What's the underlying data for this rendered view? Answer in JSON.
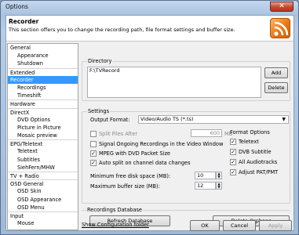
{
  "window": {
    "title": "Options"
  },
  "header": {
    "title": "Recorder",
    "description": "This section offers you to change the recording path, file format settings and buffer size."
  },
  "tree": [
    {
      "label": "General",
      "level": 0
    },
    {
      "label": "Appearance",
      "level": 1
    },
    {
      "label": "Shutdown",
      "level": 1
    },
    {
      "label": "Extended",
      "level": 0,
      "sep": true
    },
    {
      "label": "Recorder",
      "level": 0,
      "selected": true
    },
    {
      "label": "Recordings",
      "level": 1
    },
    {
      "label": "Timeshift",
      "level": 1
    },
    {
      "label": "Hardware",
      "level": 0,
      "sep": true
    },
    {
      "label": "DirectX",
      "level": 0,
      "sep": true
    },
    {
      "label": "DVD Options",
      "level": 1
    },
    {
      "label": "Picture in Picture",
      "level": 1
    },
    {
      "label": "Mosaic preview",
      "level": 1
    },
    {
      "label": "EPG/Teletext",
      "level": 0,
      "sep": true
    },
    {
      "label": "Teletext",
      "level": 1
    },
    {
      "label": "Subtitles",
      "level": 1
    },
    {
      "label": "SiehFern/MHW",
      "level": 1
    },
    {
      "label": "TV + Radio",
      "level": 0,
      "sep": true
    },
    {
      "label": "OSD General",
      "level": 0,
      "sep": true
    },
    {
      "label": "OSD Skin",
      "level": 1
    },
    {
      "label": "OSD Appearance",
      "level": 1
    },
    {
      "label": "OSD Menu",
      "level": 1
    },
    {
      "label": "Input",
      "level": 0,
      "sep": true
    },
    {
      "label": "Mouse",
      "level": 1
    }
  ],
  "directory": {
    "label": "Directory",
    "path": "F:\\TVRecord",
    "add_label": "Add",
    "delete_label": "Delete"
  },
  "settings": {
    "label": "Settings",
    "output_format_label": "Output Format:",
    "output_format_value": "Video/Audio TS (*.ts)",
    "split_files_label": "Split Files After",
    "split_value": "600",
    "split_unit": "MB",
    "signal_ongoing_label": "Signal Ongoing Recordings in the Video Window",
    "mpeg_label": "MPEG with DVD Packet Size",
    "auto_split_label": "Auto split on channel data changes",
    "min_disk_label": "Minimum free disk space (MB):",
    "min_disk_value": "10",
    "max_buffer_label": "Maximum buffer size (MB):",
    "max_buffer_value": "12"
  },
  "format_options": {
    "label": "Format Options",
    "teletext": "Teletext",
    "dvb_subtitle": "DVB Subtitle",
    "all_audiotracks": "All Audiotracks",
    "adjust_pat": "Adjust PAT/PMT"
  },
  "recordings_db": {
    "label": "Recordings Database",
    "refresh_label": "Refresh Database",
    "delete_orphans_label": "Delete Orphans"
  },
  "footer": {
    "show_config_label": "Show Configuration folder",
    "ok_label": "OK",
    "cancel_label": "Cancel",
    "apply_label": "Apply"
  }
}
